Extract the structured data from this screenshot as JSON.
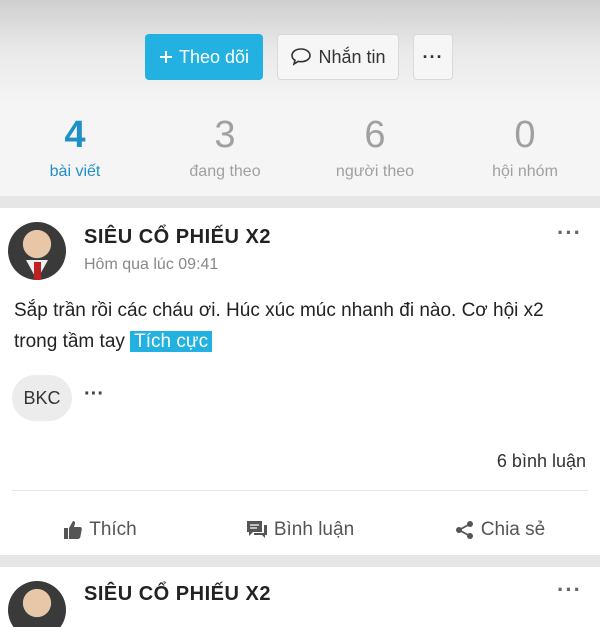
{
  "profile_actions": {
    "follow_label": "Theo dõi",
    "message_label": "Nhắn tin",
    "more_label": "···"
  },
  "stats": [
    {
      "value": "4",
      "label": "bài viết",
      "active": true
    },
    {
      "value": "3",
      "label": "đang theo",
      "active": false
    },
    {
      "value": "6",
      "label": "người theo",
      "active": false
    },
    {
      "value": "0",
      "label": "hội nhóm",
      "active": false
    }
  ],
  "posts": [
    {
      "author": "SIÊU CỔ PHIẾU X2",
      "time": "Hôm qua lúc 09:41",
      "more": "···",
      "text": "Sắp trần rồi các cháu ơi. Húc xúc múc nhanh đi nào. Cơ hội x2 trong tầm tay",
      "sentiment_tag": "Tích cực",
      "ticker": "BKC",
      "ticker_more": "···",
      "comments_count": "6 bình luận",
      "actions": {
        "like": "Thích",
        "comment": "Bình luận",
        "share": "Chia sẻ"
      }
    },
    {
      "author": "SIÊU CỔ PHIẾU X2",
      "more": "···"
    }
  ],
  "colors": {
    "accent": "#22b1e0",
    "active_stat": "#1f8fc8",
    "muted": "#a0a0a0"
  },
  "icons": {
    "follow": "plus-icon",
    "message": "chat-bubble-icon",
    "like": "thumbs-up-icon",
    "comment": "comment-icon",
    "share": "share-icon"
  }
}
